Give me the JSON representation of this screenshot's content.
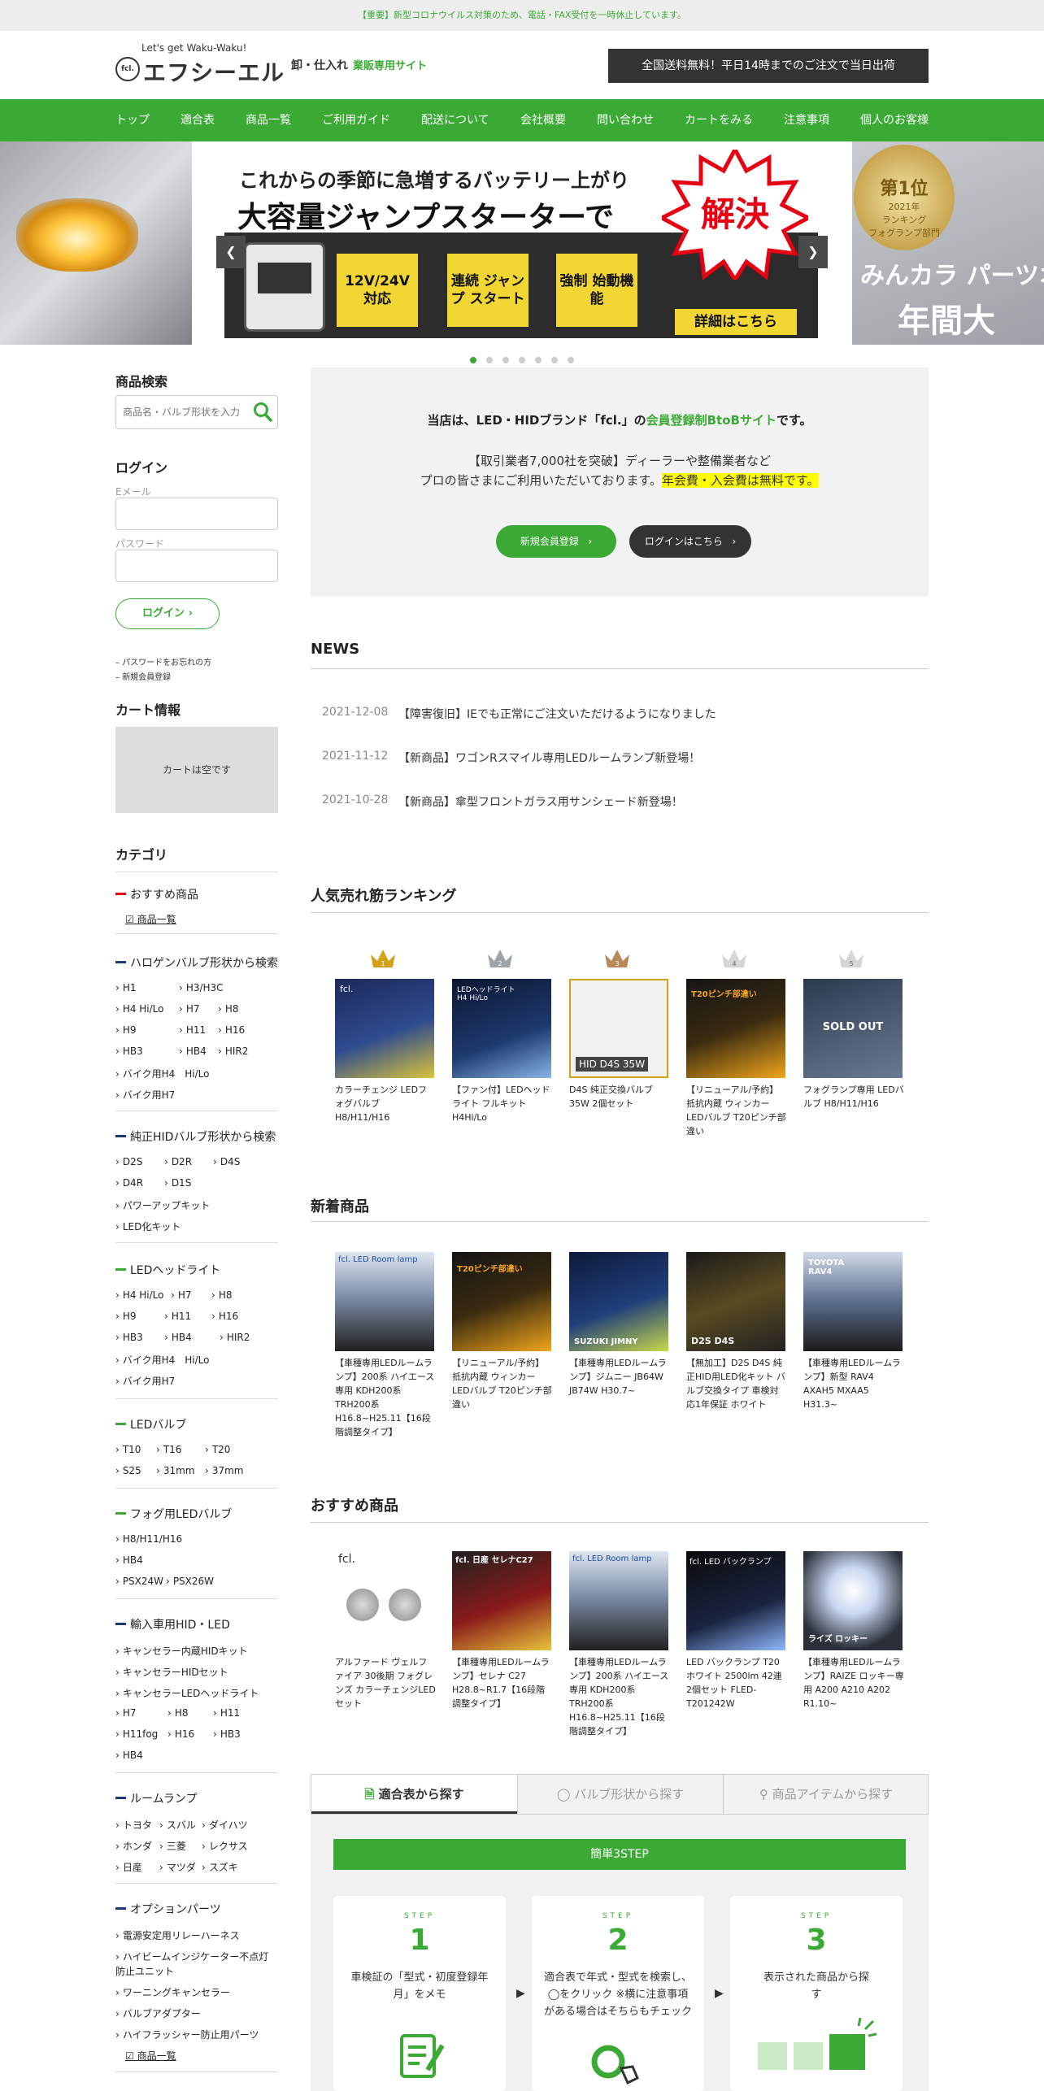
{
  "notice": "【重要】新型コロナウイルス対策のため、電話・FAX受付を一時休止しています。",
  "header": {
    "tagline": "Let's get Waku-Waku!",
    "logo_mark": "fcl.",
    "logo_name": "エフシーエル",
    "subtitle": "卸・仕入れ",
    "subtitle_green": "業販専用サイト",
    "free_shipping": "全国送料無料！平日14時までのご注文で当日出荷"
  },
  "nav": [
    "トップ",
    "適合表",
    "商品一覧",
    "ご利用ガイド",
    "配送について",
    "会社概要",
    "問い合わせ",
    "カートをみる",
    "注意事項",
    "個人のお客様"
  ],
  "hero": {
    "line1": "これからの季節に急増するバッテリー上がり",
    "line2": "大容量ジャンプスターターで",
    "burst": "解決",
    "features": [
      "12V/24V 対応",
      "連続 ジャンプ スタート",
      "強制 始動機能"
    ],
    "detail": "詳細はこちら",
    "right_medal_top": "ランキング",
    "right_medal_rank": "第1位",
    "right_medal_year": "2021年",
    "right_medal_sub": "フォグランプ部門",
    "right_line1": "みんカラ パーツオ",
    "right_line2": "年間大",
    "slides": 7,
    "active_slide": 0
  },
  "sidebar": {
    "search_title": "商品検索",
    "search_placeholder": "商品名・バルブ形状を入力",
    "login_title": "ログイン",
    "email_label": "Eメール",
    "password_label": "パスワード",
    "login_button": "ログイン",
    "forgot": "パスワードをお忘れの方",
    "register": "新規会員登録",
    "cart_title": "カート情報",
    "cart_empty": "カートは空です",
    "category_title": "カテゴリ",
    "categories": [
      {
        "title": "おすすめ商品",
        "list_link": "商品一覧"
      },
      {
        "title": "ハロゲンバルブ形状から検索",
        "items": [
          "H1",
          "H3/H3C",
          "H4 Hi/Lo",
          "H7",
          "H8",
          "H9",
          "H11",
          "H16",
          "HB3",
          "HB4",
          "HIR2",
          "バイク用H4　Hi/Lo",
          "バイク用H7"
        ]
      },
      {
        "title": "純正HIDバルブ形状から検索",
        "items": [
          "D2S",
          "D2R",
          "D4S",
          "D4R",
          "D1S",
          "パワーアップキット",
          "LED化キット"
        ]
      },
      {
        "title": "LEDヘッドライト",
        "items": [
          "H4 Hi/Lo",
          "H7",
          "H8",
          "H9",
          "H11",
          "H16",
          "HB3",
          "HB4",
          "HIR2",
          "バイク用H4　Hi/Lo",
          "バイク用H7"
        ]
      },
      {
        "title": "LEDバルブ",
        "items": [
          "T10",
          "T16",
          "T20",
          "S25",
          "31mm",
          "37mm"
        ]
      },
      {
        "title": "フォグ用LEDバルブ",
        "items": [
          "H8/H11/H16",
          "HB4",
          "PSX24W",
          "PSX26W"
        ]
      },
      {
        "title": "輸入車用HID・LED",
        "items": [
          "キャンセラー内蔵HIDキット",
          "キャンセラーHIDセット",
          "キャンセラーLEDヘッドライト",
          "H7",
          "H8",
          "H11",
          "H11fog",
          "H16",
          "HB3",
          "HB4"
        ]
      },
      {
        "title": "ルームランプ",
        "items": [
          "トヨタ",
          "スバル",
          "ダイハツ",
          "ホンダ",
          "三菱",
          "レクサス",
          "日産",
          "マツダ",
          "スズキ"
        ]
      },
      {
        "title": "オプションパーツ",
        "items": [
          "電源安定用リレーハーネス",
          "ハイビームインジケーター不点灯防止ユニット",
          "ワーニングキャンセラー",
          "バルブアダプター",
          "ハイフラッシャー防止用パーツ"
        ],
        "list_link": "商品一覧"
      }
    ]
  },
  "welcome": {
    "line1_pre": "当店は、LED・HIDブランド「fcl.」の",
    "line1_green": "会員登録制BtoBサイト",
    "line1_post": "です。",
    "line2": "【取引業者7,000社を突破】ディーラーや整備業者など",
    "line3_pre": "プロの皆さまにご利用いただいております。",
    "line3_hl": "年会費・入会費は無料です。",
    "register_button": "新規会員登録",
    "login_button": "ログインはこちら"
  },
  "news": {
    "title": "NEWS",
    "items": [
      {
        "date": "2021-12-08",
        "text": "【障害復旧】IEでも正常にご注文いただけるようになりました"
      },
      {
        "date": "2021-11-12",
        "text": "【新商品】ワゴンRスマイル専用LEDルームランプ新登場！"
      },
      {
        "date": "2021-10-28",
        "text": "【新商品】傘型フロントガラス用サンシェード新登場！"
      }
    ]
  },
  "ranking": {
    "title": "人気売れ筋ランキング",
    "ranks": [
      "1",
      "2",
      "3",
      "4",
      "5"
    ],
    "products": [
      {
        "caption": "カラーチェンジ LEDフォグバルブ H8/H11/H16",
        "img_text": "fcl."
      },
      {
        "caption": "【ファン付】LEDヘッドライト フルキット H4Hi/Lo",
        "img_text": "LEDヘッドライト H4 Hi/Lo"
      },
      {
        "caption": "D4S 純正交換バルブ 35W 2個セット",
        "img_text": "HID D4S 35W"
      },
      {
        "caption": "【リニューアル/予約】抵抗内蔵 ウィンカーLEDバルブ T20ピンチ部違い",
        "img_text": "T20ピンチ部違い"
      },
      {
        "caption": "フォグランプ専用 LEDバルブ H8/H11/H16",
        "img_text": "SOLD OUT"
      }
    ]
  },
  "new_items": {
    "title": "新着商品",
    "products": [
      {
        "caption": "【車種専用LEDルームランプ】200系 ハイエース専用 KDH200系 TRH200系 H16.8~H25.11【16段階調整タイプ】",
        "img_text": "fcl. LED Room lamp"
      },
      {
        "caption": "【リニューアル/予約】抵抗内蔵 ウィンカーLEDバルブ T20ピンチ部違い",
        "img_text": "T20ピンチ部違い"
      },
      {
        "caption": "【車種専用LEDルームランプ】ジムニー JB64W JB74W H30.7~",
        "img_text": "SUZUKI JIMNY"
      },
      {
        "caption": "【無加工】D2S D4S 純正HID用LED化キット バルブ交換タイプ 車検対応1年保証 ホワイト",
        "img_text": "D2S D4S"
      },
      {
        "caption": "【車種専用LEDルームランプ】新型 RAV4 AXAH5 MXAA5 H31.3~",
        "img_text": "TOYOTA RAV4"
      }
    ]
  },
  "recommended": {
    "title": "おすすめ商品",
    "products": [
      {
        "caption": "アルファード ヴェルファイア 30後期 フォグレンズ カラーチェンジLEDセット",
        "img_text": "fcl."
      },
      {
        "caption": "【車種専用LEDルームランプ】セレナ C27 H28.8~R1.7【16段階調整タイプ】",
        "img_text": "fcl. 日産 セレナC27"
      },
      {
        "caption": "【車種専用LEDルームランプ】200系 ハイエース専用 KDH200系 TRH200系 H16.8~H25.11【16段階調整タイプ】",
        "img_text": "fcl. LED Room lamp"
      },
      {
        "caption": "LED バックランプ T20 ホワイト 2500lm 42連 2個セット FLED-T201242W",
        "img_text": "fcl. LED バックランプ"
      },
      {
        "caption": "【車種専用LEDルームランプ】RAIZE ロッキー専用 A200 A210 A202 R1.10~",
        "img_text": "ライズ ロッキー"
      }
    ]
  },
  "finder": {
    "tabs": [
      "適合表から探す",
      "バルブ形状から探す",
      "商品アイテムから探す"
    ],
    "active_tab": 0,
    "bar": "簡単3STEP",
    "step_label": "STEP",
    "steps": [
      {
        "num": "1",
        "text": "車検証の「型式・初度登録年月」をメモ"
      },
      {
        "num": "2",
        "text": "適合表で年式・型式を検索し、◯をクリック ※横に注意事項がある場合はそちらもチェック"
      },
      {
        "num": "3",
        "text": "表示された商品から探す"
      }
    ]
  },
  "colors": {
    "brand_green": "#3aaa35",
    "dark": "#333333",
    "highlight": "#ffff00",
    "accent_red": "#e60012"
  }
}
